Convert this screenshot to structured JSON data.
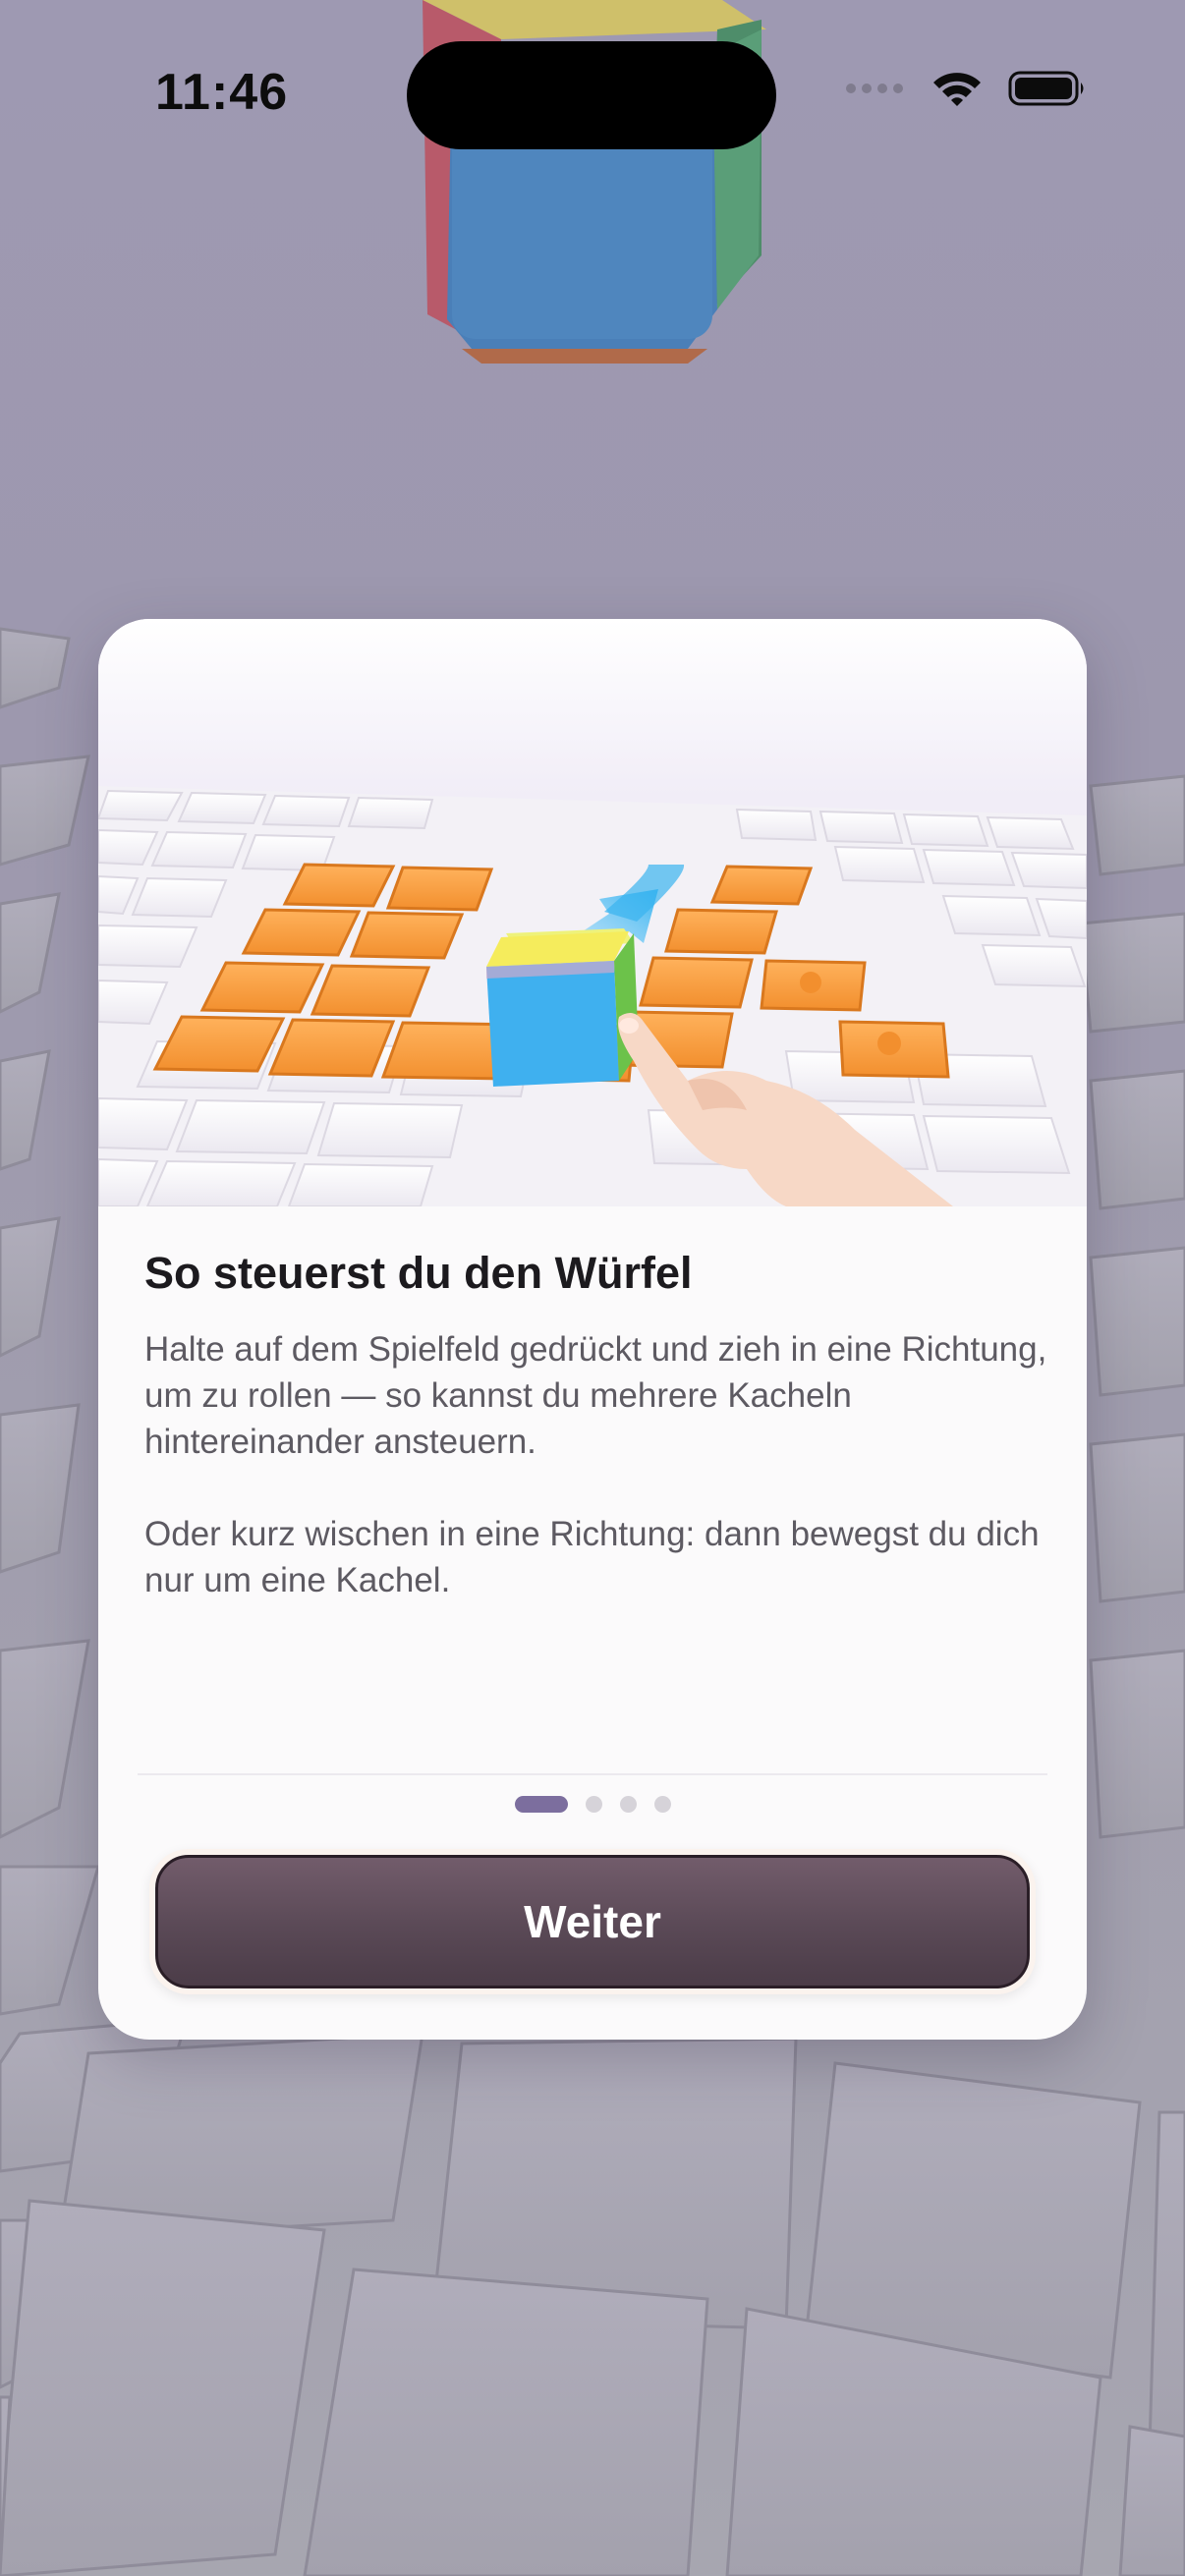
{
  "status_bar": {
    "time": "11:46"
  },
  "tutorial": {
    "title": "So steuerst du den Würfel",
    "paragraph_1": "Halte auf dem Spielfeld gedrückt und zieh in eine Richtung, um zu rollen — so kannst du mehrere Kacheln hintereinander ansteuern.",
    "paragraph_2": "Oder kurz wischen in eine Richtung: dann bewegst du dich nur um eine Kachel.",
    "page_indicator": {
      "current": 1,
      "total": 4
    },
    "button_label": "Weiter"
  },
  "icons": [
    "cellular-signal-icon",
    "wifi-icon",
    "battery-icon",
    "cube-illustration",
    "swipe-arrow-icon",
    "hand-icon"
  ],
  "colors": {
    "background": "#9e99b2",
    "card": "#fbfafb",
    "button": "#5a4956",
    "active_dot": "#7c6e9e",
    "tile_orange": "#f7a048"
  }
}
